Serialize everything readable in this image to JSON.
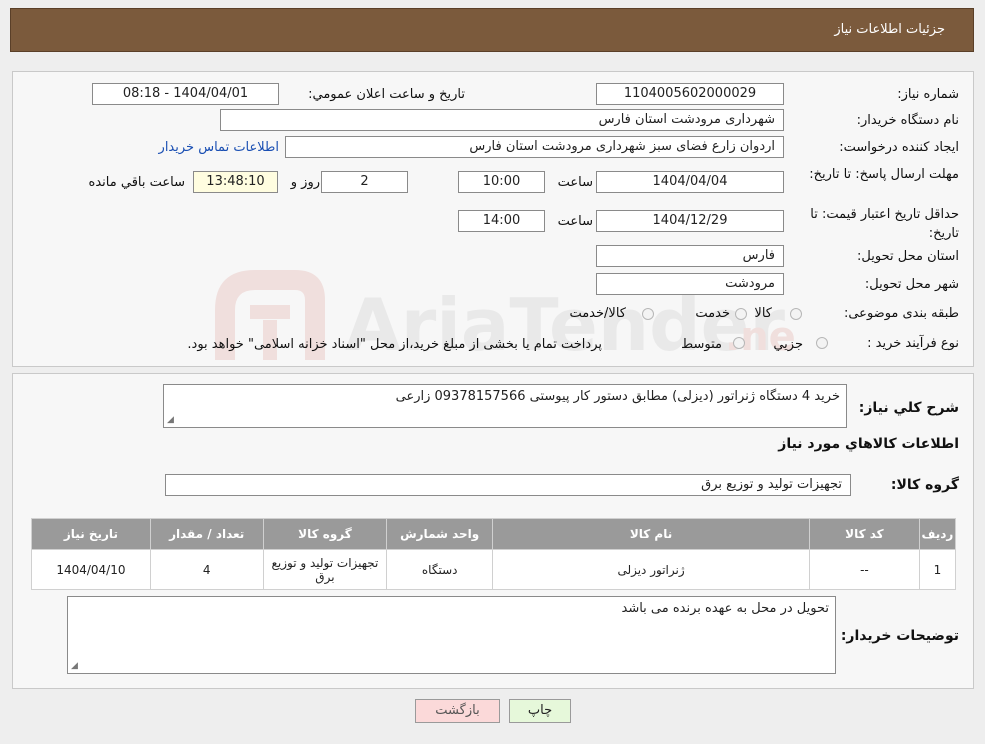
{
  "header": {
    "title": "جزئیات اطلاعات نیاز"
  },
  "form": {
    "need_number_label": "شماره نیاز:",
    "need_number": "1104005602000029",
    "announce_label": "تاریخ و ساعت اعلان عمومي:",
    "announce_value": "1404/04/01 - 08:18",
    "buyer_org_label": "نام دستگاه خريدار:",
    "buyer_org": "شهرداری مرودشت استان فارس",
    "requester_label": "ايجاد کننده درخواست:",
    "requester": "اردوان زارع فضای سبز شهرداری مرودشت استان فارس",
    "contact_link": "اطلاعات تماس خريدار",
    "deadline_label": "مهلت ارسال پاسخ: تا تاریخ:",
    "deadline_date": "1404/04/04",
    "time_word": "ساعت",
    "deadline_time": "10:00",
    "days_value": "2",
    "days_word": "روز و",
    "remaining_time": "13:48:10",
    "remaining_label": "ساعت باقي مانده",
    "validity_label": "حداقل تاريخ اعتبار قيمت: تا تاریخ:",
    "validity_date": "1404/12/29",
    "validity_time": "14:00",
    "province_label": "استان محل تحويل:",
    "province": "فارس",
    "city_label": "شهر محل تحويل:",
    "city": "مرودشت",
    "category_label": "طبقه بندی موضوعی:",
    "category_options": [
      "کالا",
      "خدمت",
      "کالا/خدمت"
    ],
    "purchase_type_label": "نوع فرآيند خريد :",
    "purchase_options": [
      "جزيي",
      "متوسط"
    ],
    "purchase_note": "پرداخت تمام یا بخشی از مبلغ خرید،از محل \"اسناد خزانه اسلامی\" خواهد بود."
  },
  "details": {
    "description_label": "شرح کلي نياز:",
    "description": "خريد 4 دستگاه ژنراتور (ديزلی) مطابق دستور کار پيوستی 09378157566 زارعی",
    "goods_info_title": "اطلاعات کالاهاي مورد نياز",
    "goods_group_label": "گروه کالا:",
    "goods_group": "تجهیزات تولید و توزیع برق",
    "table": {
      "headers": [
        "رديف",
        "کد کالا",
        "نام کالا",
        "واحد شمارش",
        "گروه کالا",
        "تعداد / مقدار",
        "تاريخ نياز"
      ],
      "rows": [
        [
          "1",
          "--",
          "ژنراتور ديزلی",
          "دستگاه",
          "تجهیزات تولید و توزیع برق",
          "4",
          "1404/04/10"
        ]
      ]
    },
    "buyer_notes_label": "توضيحات خريدار:",
    "buyer_notes": "تحویل در محل به عهده برنده می باشد"
  },
  "buttons": {
    "print": "چاپ",
    "back": "بازگشت"
  },
  "colors": {
    "header_bg": "#7b5a3c",
    "table_header_bg": "#9a9a9a",
    "back_button_bg": "#fbd9d9",
    "print_button_bg": "#e6f8da"
  }
}
